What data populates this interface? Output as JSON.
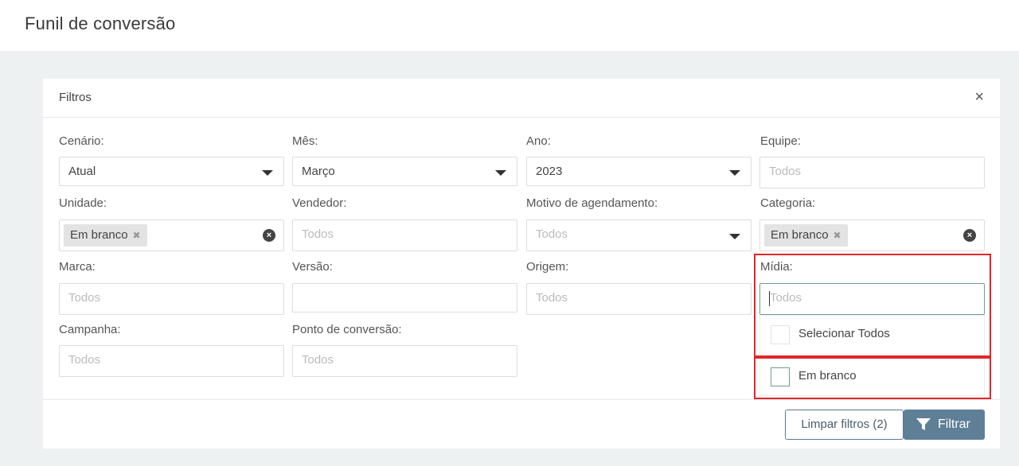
{
  "page": {
    "title": "Funil de conversão"
  },
  "filters": {
    "title": "Filtros",
    "close_symbol": "×",
    "cenario": {
      "label": "Cenário:",
      "value": "Atual"
    },
    "mes": {
      "label": "Mês:",
      "value": "Março"
    },
    "ano": {
      "label": "Ano:",
      "value": "2023"
    },
    "equipe": {
      "label": "Equipe:",
      "placeholder": "Todos"
    },
    "unidade": {
      "label": "Unidade:",
      "tag": "Em branco"
    },
    "vendedor": {
      "label": "Vendedor:",
      "placeholder": "Todos"
    },
    "motivo": {
      "label": "Motivo de agendamento:",
      "placeholder": "Todos"
    },
    "categoria": {
      "label": "Categoria:",
      "tag": "Em branco"
    },
    "marca": {
      "label": "Marca:",
      "placeholder": "Todos"
    },
    "versao": {
      "label": "Versão:",
      "placeholder": ""
    },
    "origem": {
      "label": "Origem:",
      "placeholder": "Todos"
    },
    "midia": {
      "label": "Mídia:",
      "placeholder": "Todos",
      "options": [
        {
          "label": "Selecionar Todos"
        },
        {
          "label": "Em branco"
        }
      ]
    },
    "campanha": {
      "label": "Campanha:",
      "placeholder": "Todos"
    },
    "ponto": {
      "label": "Ponto de conversão:",
      "placeholder": "Todos"
    }
  },
  "actions": {
    "clear_label": "Limpar filtros (2)",
    "filter_label": "Filtrar"
  },
  "colors": {
    "accent_green": "#6e9f86",
    "primary_button": "#5f7f97",
    "highlight_red": "#e0262b"
  }
}
